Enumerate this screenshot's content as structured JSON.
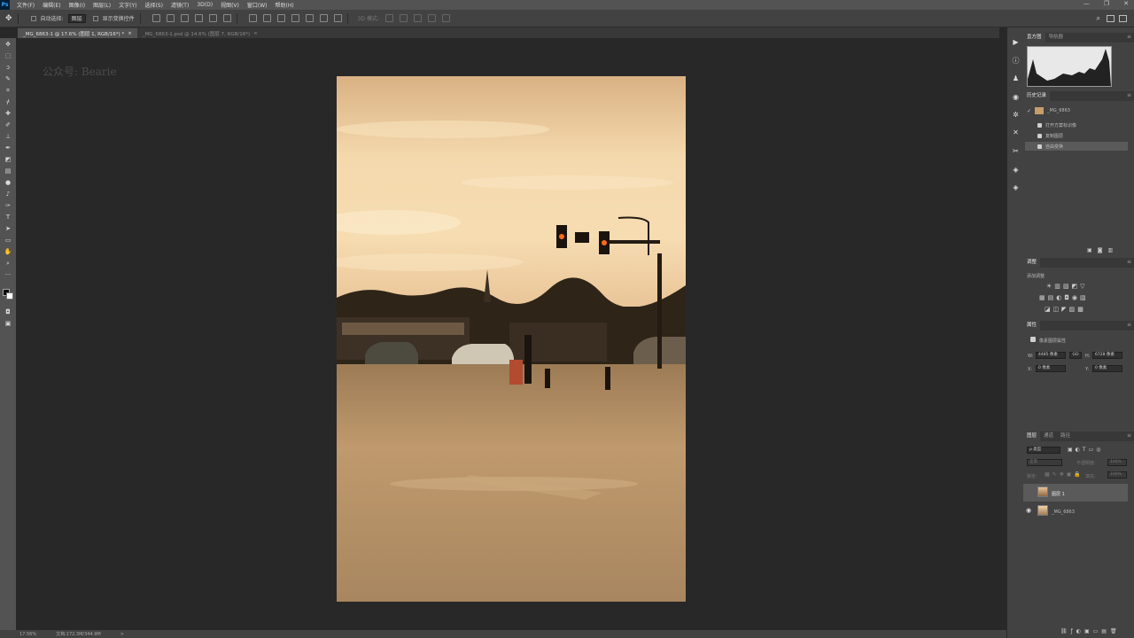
{
  "menu": {
    "app_logo": "Ps",
    "items": [
      "文件(F)",
      "编辑(E)",
      "图像(I)",
      "图层(L)",
      "文字(Y)",
      "选择(S)",
      "滤镜(T)",
      "3D(D)",
      "视图(V)",
      "窗口(W)",
      "帮助(H)"
    ],
    "window_controls": [
      "—",
      "❐",
      "✕"
    ]
  },
  "options": {
    "auto_select_label": "自动选择:",
    "auto_select_value": "图层",
    "show_transform_label": "显示变换控件",
    "mode_label": "3D 模式:"
  },
  "tabs": [
    {
      "label": "_MG_6863-1 @ 17.6% (图层 1, RGB/16*) *",
      "close": "×"
    },
    {
      "label": "_MG_6863-1.psd @ 14.6% (图层 7, RGB/16*)",
      "close": "×"
    }
  ],
  "watermark": "公众号: Bearie",
  "status": {
    "zoom": "17.56%",
    "doc": "文档:172.3M/344.9M",
    "arrow": ">"
  },
  "panels": {
    "histogram": {
      "tabs": [
        "直方图",
        "导航器"
      ]
    },
    "history": {
      "tab": "历史记录",
      "snapshot": "_MG_6863",
      "items": [
        "打开方案标识像",
        "复制图层",
        "自由变换"
      ]
    },
    "adjustments": {
      "tab": "调整",
      "hint": "添加调整"
    },
    "properties": {
      "tab": "属性",
      "title": "像素图层属性",
      "w_label": "W:",
      "w_value": "4485 像素",
      "link_icon": "GO",
      "h_label": "H:",
      "h_value": "6728 像素",
      "x_label": "X:",
      "x_value": "0 像素",
      "y_label": "Y:",
      "y_value": "0 像素"
    },
    "layers": {
      "tabs": [
        "图层",
        "通道",
        "路径"
      ],
      "kind_label": "ρ 类型",
      "blend_mode": "正常",
      "opacity_label": "不透明度:",
      "opacity_value": "100%",
      "lock_label": "锁定:",
      "fill_label": "填充:",
      "fill_value": "100%",
      "items": [
        {
          "name": "图层 1",
          "selected": true,
          "visible": false
        },
        {
          "name": "_MG_6863",
          "selected": false,
          "visible": true
        }
      ]
    }
  },
  "colors": {
    "menubar": "#535353",
    "panel": "#424242",
    "canvas_bg": "#282828",
    "photo_sky": "#f0d2a4"
  }
}
